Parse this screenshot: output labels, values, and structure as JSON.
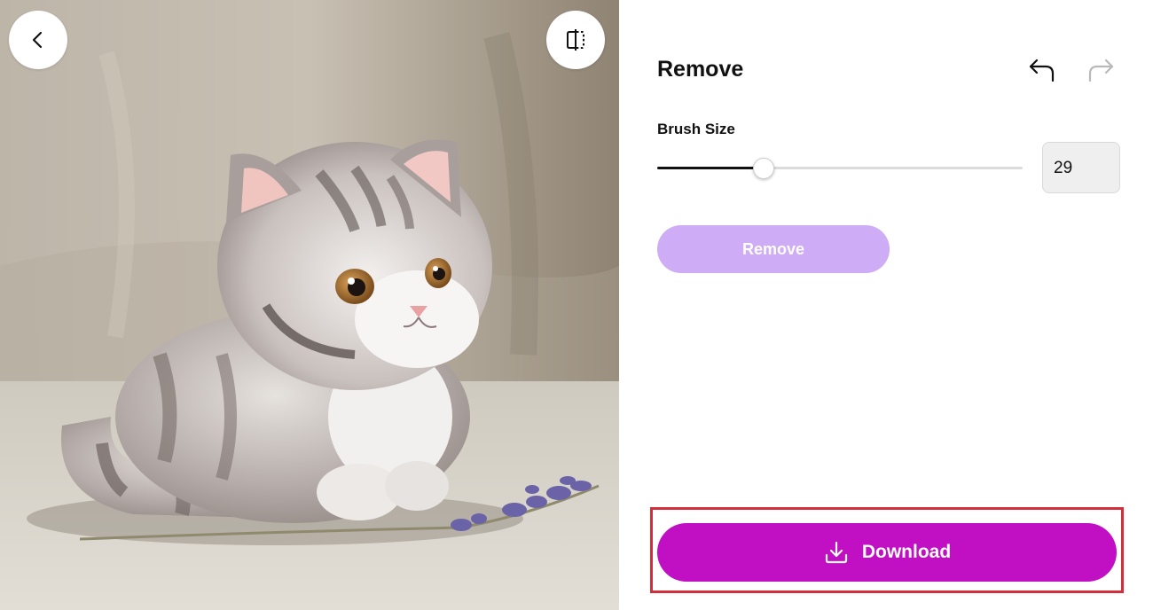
{
  "canvas": {
    "image_subject": "Needle-felted grey tabby kitten with lavender sprig",
    "back_icon": "chevron-left-icon",
    "compare_icon": "compare-split-icon"
  },
  "panel": {
    "title": "Remove",
    "undo_icon": "undo-icon",
    "redo_icon": "redo-icon",
    "brush": {
      "label": "Brush Size",
      "value": "29",
      "fraction": 0.29
    },
    "remove_label": "Remove",
    "download_label": "Download",
    "download_icon": "download-icon"
  },
  "colors": {
    "accent": "#c10fc4",
    "remove_disabled": "#cfacf6",
    "highlight_border": "#d32f3a"
  }
}
